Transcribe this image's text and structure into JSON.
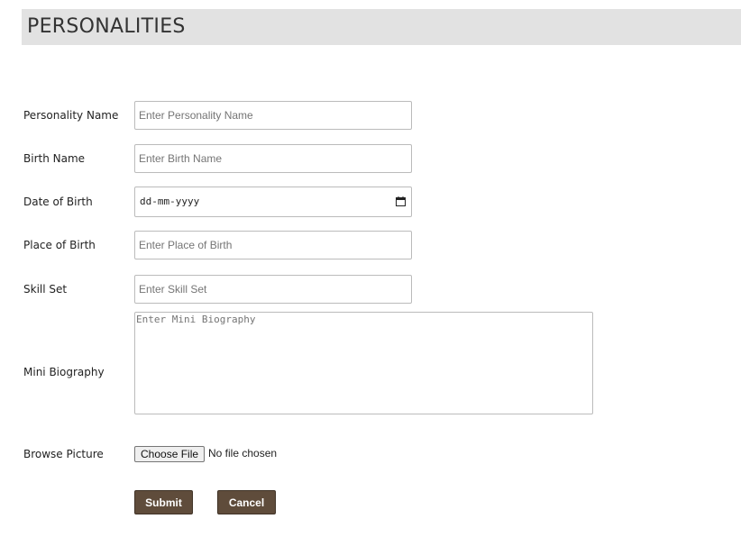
{
  "header": {
    "title": "PERSONALITIES"
  },
  "form": {
    "personality_name": {
      "label": "Personality Name",
      "placeholder": "Enter Personality Name"
    },
    "birth_name": {
      "label": "Birth Name",
      "placeholder": "Enter Birth Name"
    },
    "date_of_birth": {
      "label": "Date of Birth",
      "value": "dd-mm-yyyy",
      "icon": "calendar-icon"
    },
    "place_of_birth": {
      "label": "Place of Birth",
      "placeholder": "Enter Place of Birth"
    },
    "skill_set": {
      "label": "Skill Set",
      "placeholder": "Enter Skill Set"
    },
    "mini_biography": {
      "label": "Mini Biography",
      "placeholder": "Enter Mini Biography"
    },
    "browse_picture": {
      "label": "Browse Picture",
      "button_label": "Choose File",
      "status": "No file chosen"
    }
  },
  "actions": {
    "submit_label": "Submit",
    "cancel_label": "Cancel"
  },
  "colors": {
    "header_bg": "#e2e2e2",
    "button_bg": "#5f4c3b",
    "button_text": "#ffffff"
  }
}
